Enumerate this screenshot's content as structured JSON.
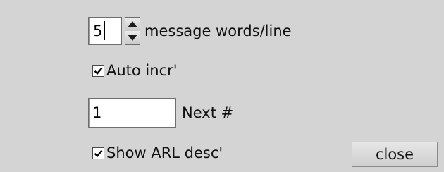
{
  "words_per_line": {
    "value": "5",
    "label": "message words/line"
  },
  "auto_increment": {
    "checked": true,
    "label": "Auto incr'"
  },
  "next_number": {
    "value": "1",
    "label": "Next #"
  },
  "show_arl_desc": {
    "checked": true,
    "label": "Show ARL desc'"
  },
  "close_button": {
    "label": "close"
  },
  "icons": {
    "spin_up": "arrow-up-icon",
    "spin_down": "arrow-down-icon",
    "check": "checkmark-icon"
  },
  "colors": {
    "background": "#d4d4d4",
    "field": "#ffffff",
    "border": "#6e6e6e"
  }
}
